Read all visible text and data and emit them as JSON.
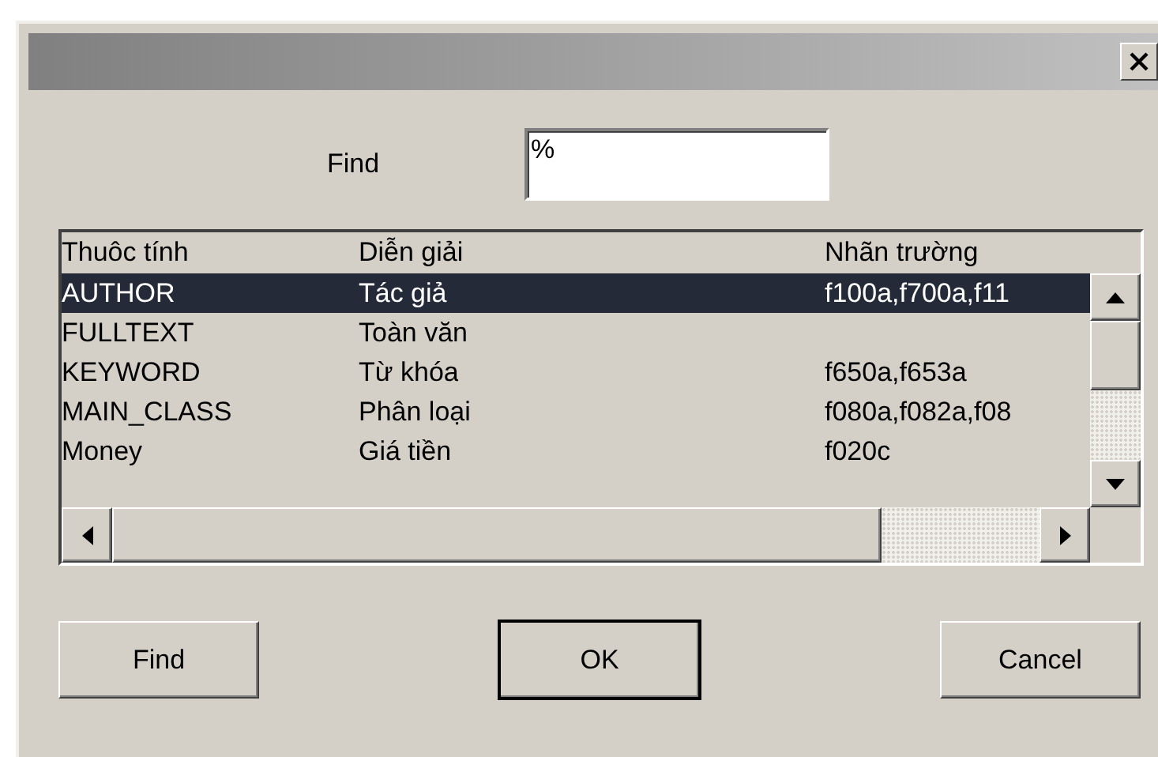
{
  "find": {
    "label": "Find",
    "value": "%"
  },
  "list": {
    "columns": [
      "Thuôc tính",
      "Diễn giải",
      "Nhãn trường"
    ],
    "rows": [
      {
        "cells": [
          "AUTHOR",
          "Tác giả",
          "f100a,f700a,f11"
        ],
        "selected": true
      },
      {
        "cells": [
          "FULLTEXT",
          "Toàn văn",
          ""
        ],
        "selected": false
      },
      {
        "cells": [
          "KEYWORD",
          "Từ khóa",
          "f650a,f653a"
        ],
        "selected": false
      },
      {
        "cells": [
          "MAIN_CLASS",
          "Phân loại",
          "f080a,f082a,f08"
        ],
        "selected": false
      },
      {
        "cells": [
          "Money",
          "Giá tiền",
          "f020c"
        ],
        "selected": false
      }
    ]
  },
  "buttons": [
    {
      "label": "Find",
      "default": false
    },
    {
      "label": "OK",
      "default": true
    },
    {
      "label": "Cancel",
      "default": false
    }
  ]
}
